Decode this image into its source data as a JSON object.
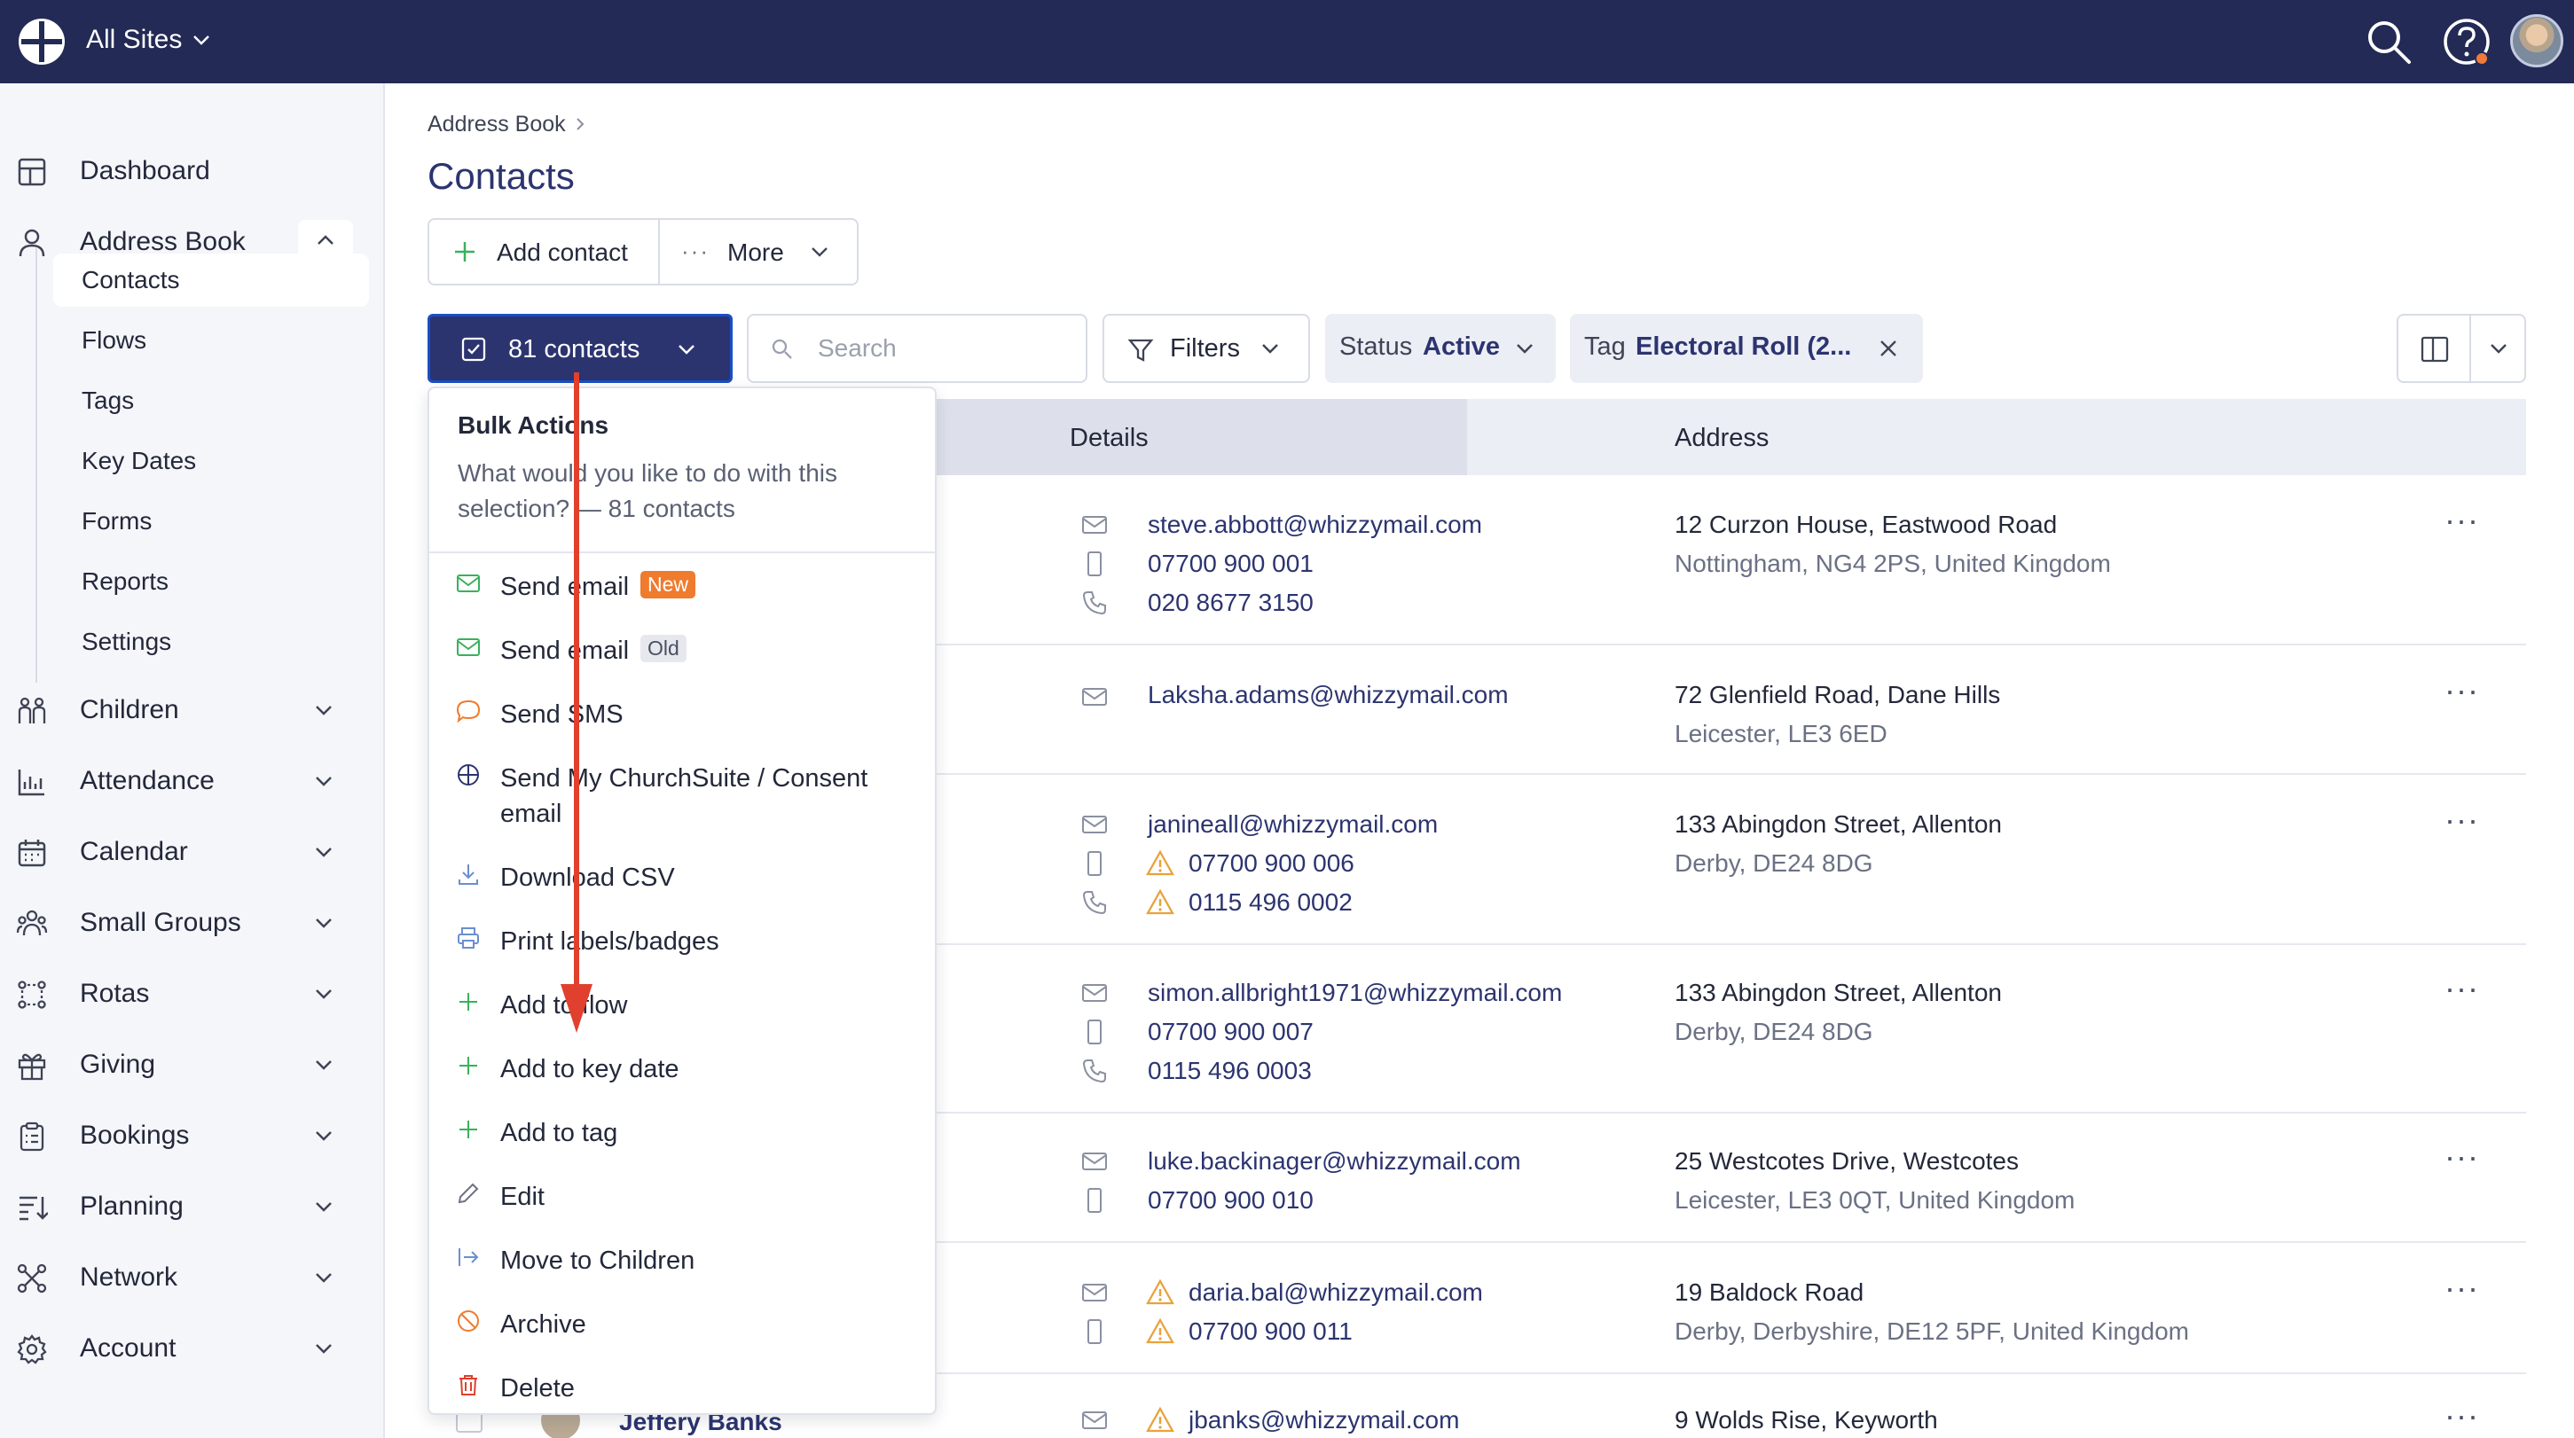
{
  "topbar": {
    "site_selector": "All Sites"
  },
  "sidebar": {
    "items": [
      {
        "label": "Dashboard"
      },
      {
        "label": "Address Book"
      },
      {
        "label": "Children"
      },
      {
        "label": "Attendance"
      },
      {
        "label": "Calendar"
      },
      {
        "label": "Small Groups"
      },
      {
        "label": "Rotas"
      },
      {
        "label": "Giving"
      },
      {
        "label": "Bookings"
      },
      {
        "label": "Planning"
      },
      {
        "label": "Network"
      },
      {
        "label": "Account"
      }
    ],
    "address_book_sub": [
      {
        "label": "Contacts"
      },
      {
        "label": "Flows"
      },
      {
        "label": "Tags"
      },
      {
        "label": "Key Dates"
      },
      {
        "label": "Forms"
      },
      {
        "label": "Reports"
      },
      {
        "label": "Settings"
      }
    ]
  },
  "breadcrumb": "Address Book",
  "page_title": "Contacts",
  "toolbar": {
    "add_contact": "Add contact",
    "more": "More"
  },
  "filters": {
    "selection": "81 contacts",
    "search_placeholder": "Search",
    "filters_label": "Filters",
    "status_key": "Status",
    "status_value": "Active",
    "tag_key": "Tag",
    "tag_value": "Electoral Roll (2..."
  },
  "table": {
    "headers": {
      "details": "Details",
      "address": "Address"
    },
    "rows": [
      {
        "details": [
          "steve.abbott@whizzymail.com",
          "07700 900 001",
          "020 8677 3150"
        ],
        "address": [
          "12 Curzon House, Eastwood Road",
          "Nottingham, NG4 2PS, United Kingdom"
        ]
      },
      {
        "details": [
          "Laksha.adams@whizzymail.com"
        ],
        "address": [
          "72 Glenfield Road, Dane Hills",
          "Leicester, LE3 6ED"
        ]
      },
      {
        "details": [
          "janineall@whizzymail.com",
          "07700 900 006",
          "0115 496 0002"
        ],
        "address": [
          "133 Abingdon Street, Allenton",
          "Derby, DE24 8DG"
        ]
      },
      {
        "details": [
          "simon.allbright1971@whizzymail.com",
          "07700 900 007",
          "0115 496 0003"
        ],
        "address": [
          "133 Abingdon Street, Allenton",
          "Derby, DE24 8DG"
        ]
      },
      {
        "details": [
          "luke.backinager@whizzymail.com",
          "07700 900 010"
        ],
        "address": [
          "25 Westcotes Drive, Westcotes",
          "Leicester, LE3 0QT, United Kingdom"
        ]
      },
      {
        "details": [
          "daria.bal@whizzymail.com",
          "07700 900 011"
        ],
        "address": [
          "19 Baldock Road",
          "Derby, Derbyshire, DE12 5PF, United Kingdom"
        ]
      },
      {
        "name": "Jeffery Banks",
        "details": [
          "jbanks@whizzymail.com"
        ],
        "address": [
          "9 Wolds Rise, Keyworth"
        ]
      }
    ]
  },
  "bulk_actions": {
    "title": "Bulk Actions",
    "description": "What would you like to do with this selection? — 81 contacts",
    "items": [
      {
        "label": "Send email",
        "badge": "New"
      },
      {
        "label": "Send email",
        "badge": "Old"
      },
      {
        "label": "Send SMS"
      },
      {
        "label": "Send My ChurchSuite / Consent email"
      },
      {
        "label": "Download CSV"
      },
      {
        "label": "Print labels/badges"
      },
      {
        "label": "Add to flow"
      },
      {
        "label": "Add to key date"
      },
      {
        "label": "Add to tag"
      },
      {
        "label": "Edit"
      },
      {
        "label": "Move to Children"
      },
      {
        "label": "Archive"
      },
      {
        "label": "Delete"
      }
    ]
  },
  "colors": {
    "navy": "#232a55",
    "accent": "#2c3470",
    "green": "#38b15c",
    "orange": "#ef7b2e",
    "warning": "#e9a23b",
    "red": "#e0402d"
  }
}
